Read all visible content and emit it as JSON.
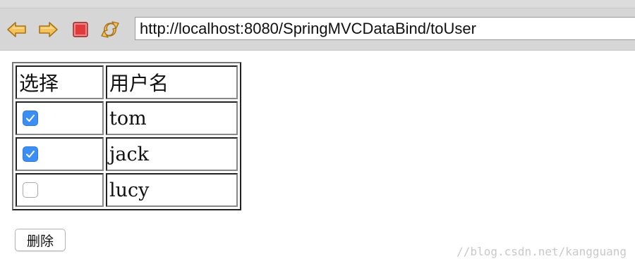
{
  "browser": {
    "url": "http://localhost:8080/SpringMVCDataBind/toUser",
    "toolbar_icons": [
      "back-arrow-icon",
      "forward-arrow-icon",
      "stop-icon",
      "reload-icon"
    ]
  },
  "table": {
    "headers": [
      "选择",
      "用户名"
    ],
    "rows": [
      {
        "checked": true,
        "name": "tom"
      },
      {
        "checked": true,
        "name": "jack"
      },
      {
        "checked": false,
        "name": "lucy"
      }
    ]
  },
  "actions": {
    "delete_label": "删除"
  },
  "watermark": "//blog.csdn.net/kangguang",
  "colors": {
    "checkbox_checked": "#3b8ef3",
    "toolbar_bg": "#d6d6d6",
    "arrow_fill": "#f4c15a",
    "stop_fill": "#e23a3a"
  }
}
